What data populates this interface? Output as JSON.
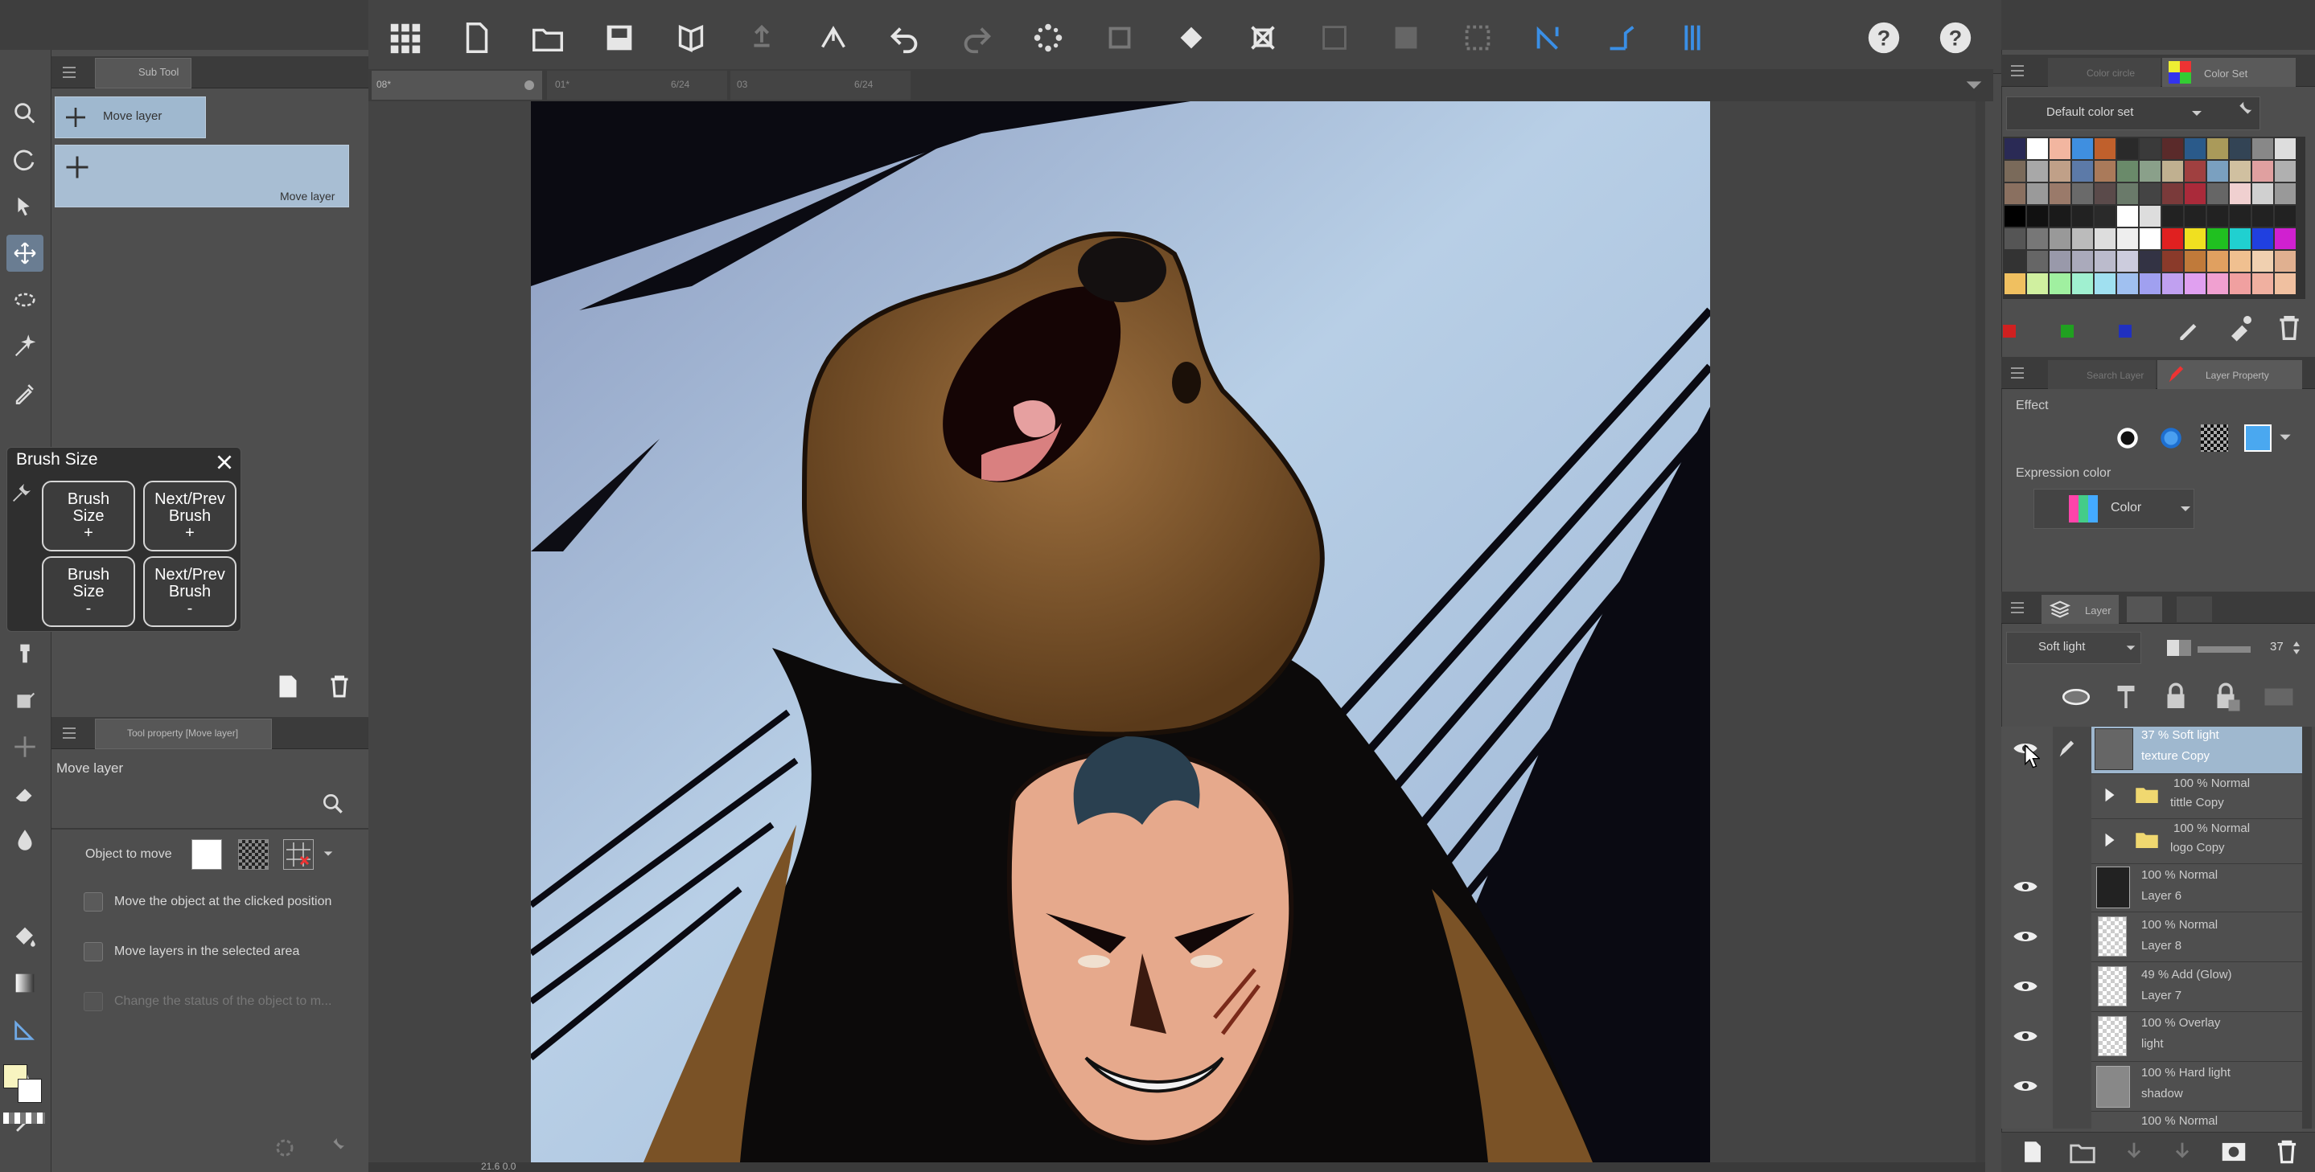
{
  "canvas_tabs": [
    {
      "label": "08*",
      "extra": ""
    },
    {
      "label": "01*",
      "extra": "6/24"
    },
    {
      "label": "03",
      "extra": "6/24"
    }
  ],
  "subtool": {
    "tab_label": "Sub Tool",
    "items": [
      {
        "label": "Move layer"
      },
      {
        "label": "Move layer"
      }
    ]
  },
  "brush_popup": {
    "title": "Brush Size",
    "buttons": [
      {
        "line1": "Brush",
        "line2": "Size",
        "line3": "+"
      },
      {
        "line1": "Next/Prev",
        "line2": "Brush",
        "line3": "+"
      },
      {
        "line1": "Brush",
        "line2": "Size",
        "line3": "-"
      },
      {
        "line1": "Next/Prev",
        "line2": "Brush",
        "line3": "-"
      }
    ]
  },
  "tool_property": {
    "tab_label": "Tool property [Move layer]",
    "tool_name": "Move layer",
    "object_to_move_label": "Object to move",
    "options": [
      {
        "label": "Move the object at the clicked position",
        "enabled": true
      },
      {
        "label": "Move layers in the selected area",
        "enabled": true
      },
      {
        "label": "Change the status of the object to m...",
        "enabled": false
      }
    ]
  },
  "color_panel": {
    "tabs": [
      "Color circle",
      "Color Set"
    ],
    "set_name": "Default color set"
  },
  "layer_property": {
    "tabs": [
      "Search Layer",
      "Layer Property"
    ],
    "effect_label": "Effect",
    "expression_label": "Expression color",
    "expression_value": "Color"
  },
  "layer_panel": {
    "tab_label": "Layer",
    "blend_mode": "Soft light",
    "opacity": "37",
    "layers": [
      {
        "line1": "37 %  Soft light",
        "line2": "texture Copy",
        "type": "layer",
        "visible": true,
        "selected": true
      },
      {
        "line1": "100 %  Normal",
        "line2": "tittle Copy",
        "type": "folder",
        "visible": false,
        "selected": false
      },
      {
        "line1": "100 %  Normal",
        "line2": "logo Copy",
        "type": "folder",
        "visible": false,
        "selected": false
      },
      {
        "line1": "100 %  Normal",
        "line2": "Layer 6",
        "type": "art",
        "visible": true,
        "selected": false
      },
      {
        "line1": "100 %  Normal",
        "line2": "Layer 8",
        "type": "layer",
        "visible": true,
        "selected": false
      },
      {
        "line1": "49 %  Add (Glow)",
        "line2": "Layer 7",
        "type": "layer",
        "visible": true,
        "selected": false
      },
      {
        "line1": "100 %  Overlay",
        "line2": "light",
        "type": "layer",
        "visible": true,
        "selected": false
      },
      {
        "line1": "100 %  Hard light",
        "line2": "shadow",
        "type": "art",
        "visible": true,
        "selected": false
      },
      {
        "line1": "100 %  Normal",
        "line2": "",
        "type": "layer",
        "visible": true,
        "selected": false
      }
    ]
  },
  "status": {
    "zoom": "21.6  0.0"
  },
  "colors": {
    "panel_bg": "#4a4a4a",
    "accent_blue": "#4a8fd8",
    "selected_item": "#9fb8cf",
    "canvas_bg": "#444444"
  }
}
